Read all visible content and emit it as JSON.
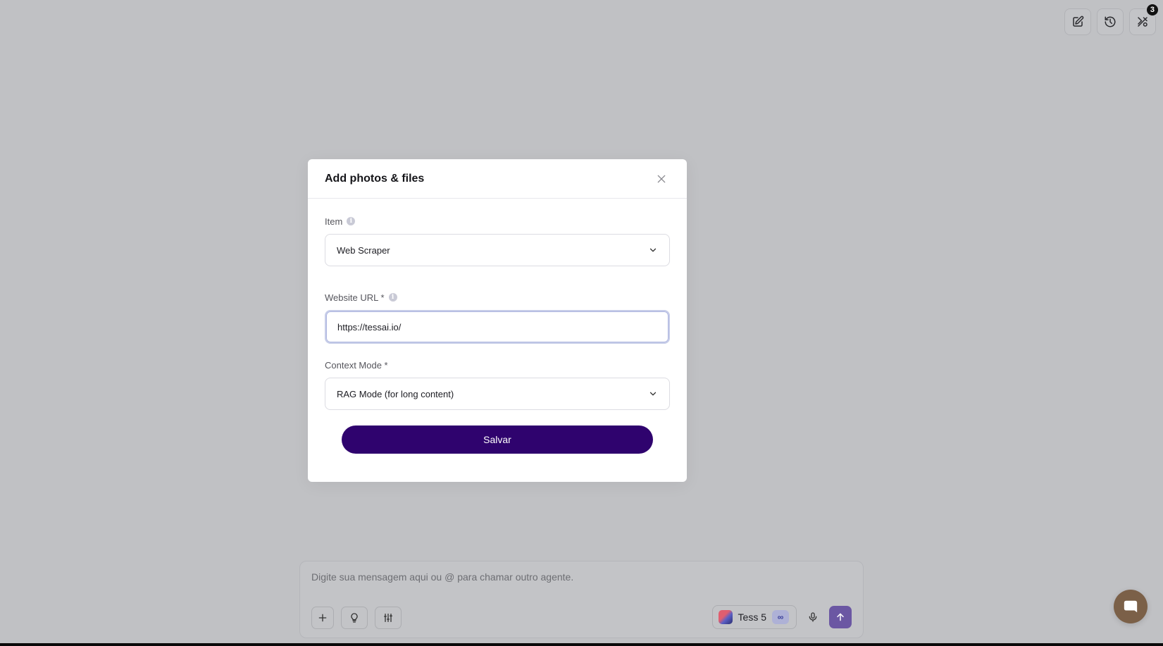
{
  "modal": {
    "title": "Add photos & files",
    "item_label": "Item",
    "item_value": "Web Scraper",
    "url_label": "Website URL *",
    "url_value": "https://tessai.io/",
    "context_label": "Context Mode *",
    "context_value": "RAG Mode (for long content)",
    "save_label": "Salvar"
  },
  "toolbar": {
    "notifications_count": "3",
    "icons": [
      "edit-icon",
      "history-icon",
      "tools-icon"
    ]
  },
  "composer": {
    "placeholder": "Digite sua mensagem aqui ou @ para chamar outro agente.",
    "agent_name": "Tess 5",
    "agent_badge": "∞"
  },
  "colors": {
    "primary": "#2f036e",
    "send": "#6b57a3",
    "overlay_bg": "#c0c1c4",
    "chat_launcher": "#7b6048"
  }
}
